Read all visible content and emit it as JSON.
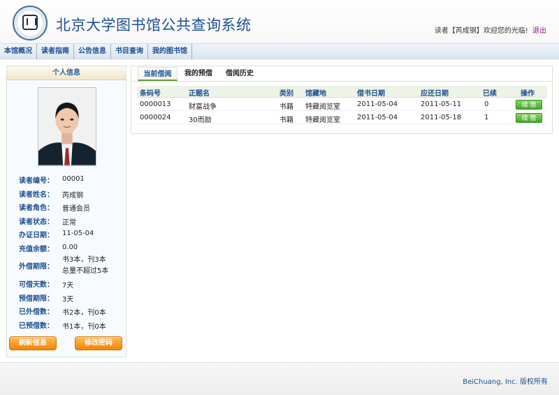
{
  "header": {
    "title": "北京大学图书馆公共查询系统",
    "welcome_prefix": "读者【芮成钢】欢迎您的光临!",
    "logout_label": "退出",
    "logo_icon": "university-seal-icon"
  },
  "nav": {
    "items": [
      "本馆概况",
      "读者指南",
      "公告信息",
      "书目查询",
      "我的图书馆"
    ]
  },
  "sidebar": {
    "title": "个人信息",
    "fields": [
      {
        "label": "读者编号：",
        "value": "00001"
      },
      {
        "label": "读者姓名：",
        "value": "芮成钢"
      },
      {
        "label": "读者角色：",
        "value": "普通会员"
      },
      {
        "label": "读者状态：",
        "value": "正常"
      },
      {
        "label": "办证日期：",
        "value": "11-05-04"
      },
      {
        "label": "充值余额：",
        "value": "0.00"
      },
      {
        "label": "外借期限：",
        "value_line1": "书3本，刊3本",
        "value_line2": "总量不超过5本"
      },
      {
        "label": "可借天数：",
        "value": "7天"
      },
      {
        "label": "预借期限：",
        "value": "3天"
      },
      {
        "label": "已外借数：",
        "value": "书2本，刊0本"
      },
      {
        "label": "已预借数：",
        "value": "书1本，刊0本"
      }
    ],
    "refresh_label": "刷新信息",
    "change_password_label": "修改密码"
  },
  "main": {
    "tabs": [
      {
        "label": "当前借阅"
      },
      {
        "label": "我的预借"
      },
      {
        "label": "借阅历史"
      }
    ],
    "table": {
      "headers": [
        "条码号",
        "正题名",
        "类别",
        "馆藏地",
        "借书日期",
        "应还日期",
        "已续",
        "操作"
      ],
      "rows": [
        {
          "barcode": "0000013",
          "title": "财富战争",
          "category": "书籍",
          "location": "特藏阅览室",
          "borrow_date": "2011-05-04",
          "due_date": "2011-05-11",
          "renewed": "0",
          "action": "续 借"
        },
        {
          "barcode": "0000024",
          "title": "30而励",
          "category": "书籍",
          "location": "特藏阅览室",
          "borrow_date": "2011-05-04",
          "due_date": "2011-05-18",
          "renewed": "1",
          "action": "续 借"
        }
      ]
    }
  },
  "footer": {
    "copyright": "BeiChuang, Inc. 版权所有"
  },
  "colors": {
    "title_blue": "#1d4f92",
    "accent_orange": "#f08500",
    "renew_green": "#44a72c"
  }
}
